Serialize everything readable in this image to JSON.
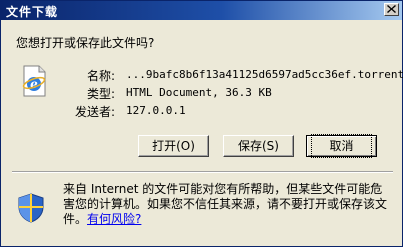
{
  "window": {
    "title": "文件下载"
  },
  "dialog": {
    "question": "您想打开或保存此文件吗?",
    "fields": [
      {
        "label": "名称:",
        "value": "...9bafc8b6f13a41125d6597ad5cc36ef.torrent"
      },
      {
        "label": "类型:",
        "value": "HTML Document, 36.3 KB"
      },
      {
        "label": "发送者:",
        "value": "127.0.0.1"
      }
    ],
    "buttons": {
      "open": "打开(O)",
      "save": "保存(S)",
      "cancel": "取消"
    },
    "warning": {
      "text": "来自 Internet 的文件可能对您有所帮助，但某些文件可能危害您的计算机。如果您不信任其来源，请不要打开或保存该文件。",
      "link": "有何风险?"
    }
  },
  "icons": {
    "file": "ie-document-icon",
    "warning": "security-shield-icon",
    "close": "close-icon"
  },
  "colors": {
    "title_bar": "#0a246a",
    "face": "#ece9d8",
    "link": "#0000ee"
  }
}
